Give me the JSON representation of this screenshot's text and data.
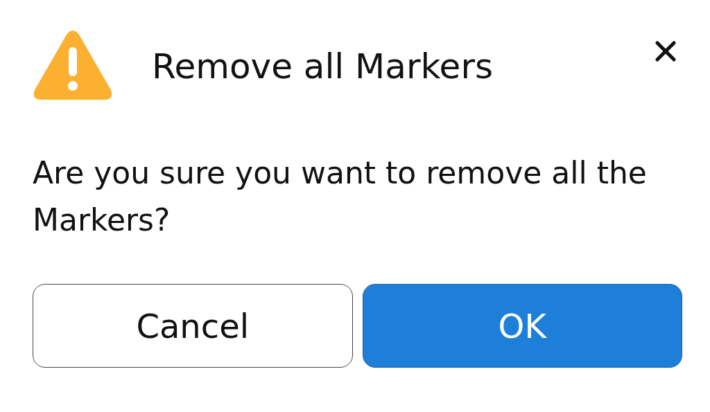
{
  "dialog": {
    "title": "Remove all Markers",
    "message": "Are you sure you want to remove all the Markers?",
    "buttons": [
      {
        "label": "Cancel",
        "kind": "secondary"
      },
      {
        "label": "OK",
        "kind": "primary"
      }
    ]
  }
}
